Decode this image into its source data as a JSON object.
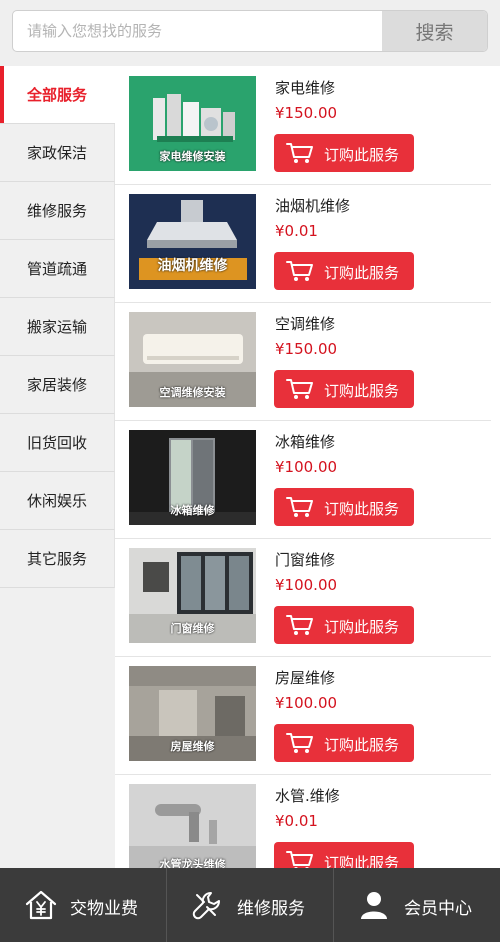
{
  "search": {
    "placeholder": "请输入您想找的服务",
    "button_label": "搜索"
  },
  "sidebar": {
    "items": [
      {
        "label": "全部服务",
        "active": true
      },
      {
        "label": "家政保洁"
      },
      {
        "label": "维修服务"
      },
      {
        "label": "管道疏通"
      },
      {
        "label": "搬家运输"
      },
      {
        "label": "家居装修"
      },
      {
        "label": "旧货回收"
      },
      {
        "label": "休闲娱乐"
      },
      {
        "label": "其它服务"
      }
    ]
  },
  "products": [
    {
      "name": "家电维修",
      "price": "¥150.00",
      "image_caption": "家电维修安装",
      "order_label": "订购此服务"
    },
    {
      "name": "油烟机维修",
      "price": "¥0.01",
      "image_caption": "油烟机维修",
      "order_label": "订购此服务"
    },
    {
      "name": "空调维修",
      "price": "¥150.00",
      "image_caption": "空调维修安装",
      "order_label": "订购此服务"
    },
    {
      "name": "冰箱维修",
      "price": "¥100.00",
      "image_caption": "冰箱维修",
      "order_label": "订购此服务"
    },
    {
      "name": "门窗维修",
      "price": "¥100.00",
      "image_caption": "门窗维修",
      "order_label": "订购此服务"
    },
    {
      "name": "房屋维修",
      "price": "¥100.00",
      "image_caption": "房屋维修",
      "order_label": "订购此服务"
    },
    {
      "name": "水管.维修",
      "price": "¥0.01",
      "image_caption": "水管龙头维修",
      "order_label": "订购此服务"
    }
  ],
  "bottom_nav": {
    "items": [
      {
        "label": "交物业费",
        "icon": "house-yuan-icon"
      },
      {
        "label": "维修服务",
        "icon": "wrench-icon"
      },
      {
        "label": "会员中心",
        "icon": "user-icon"
      }
    ]
  },
  "colors": {
    "accent": "#e8303a",
    "price": "#d4121e",
    "nav_bg": "#3b3b3b"
  }
}
